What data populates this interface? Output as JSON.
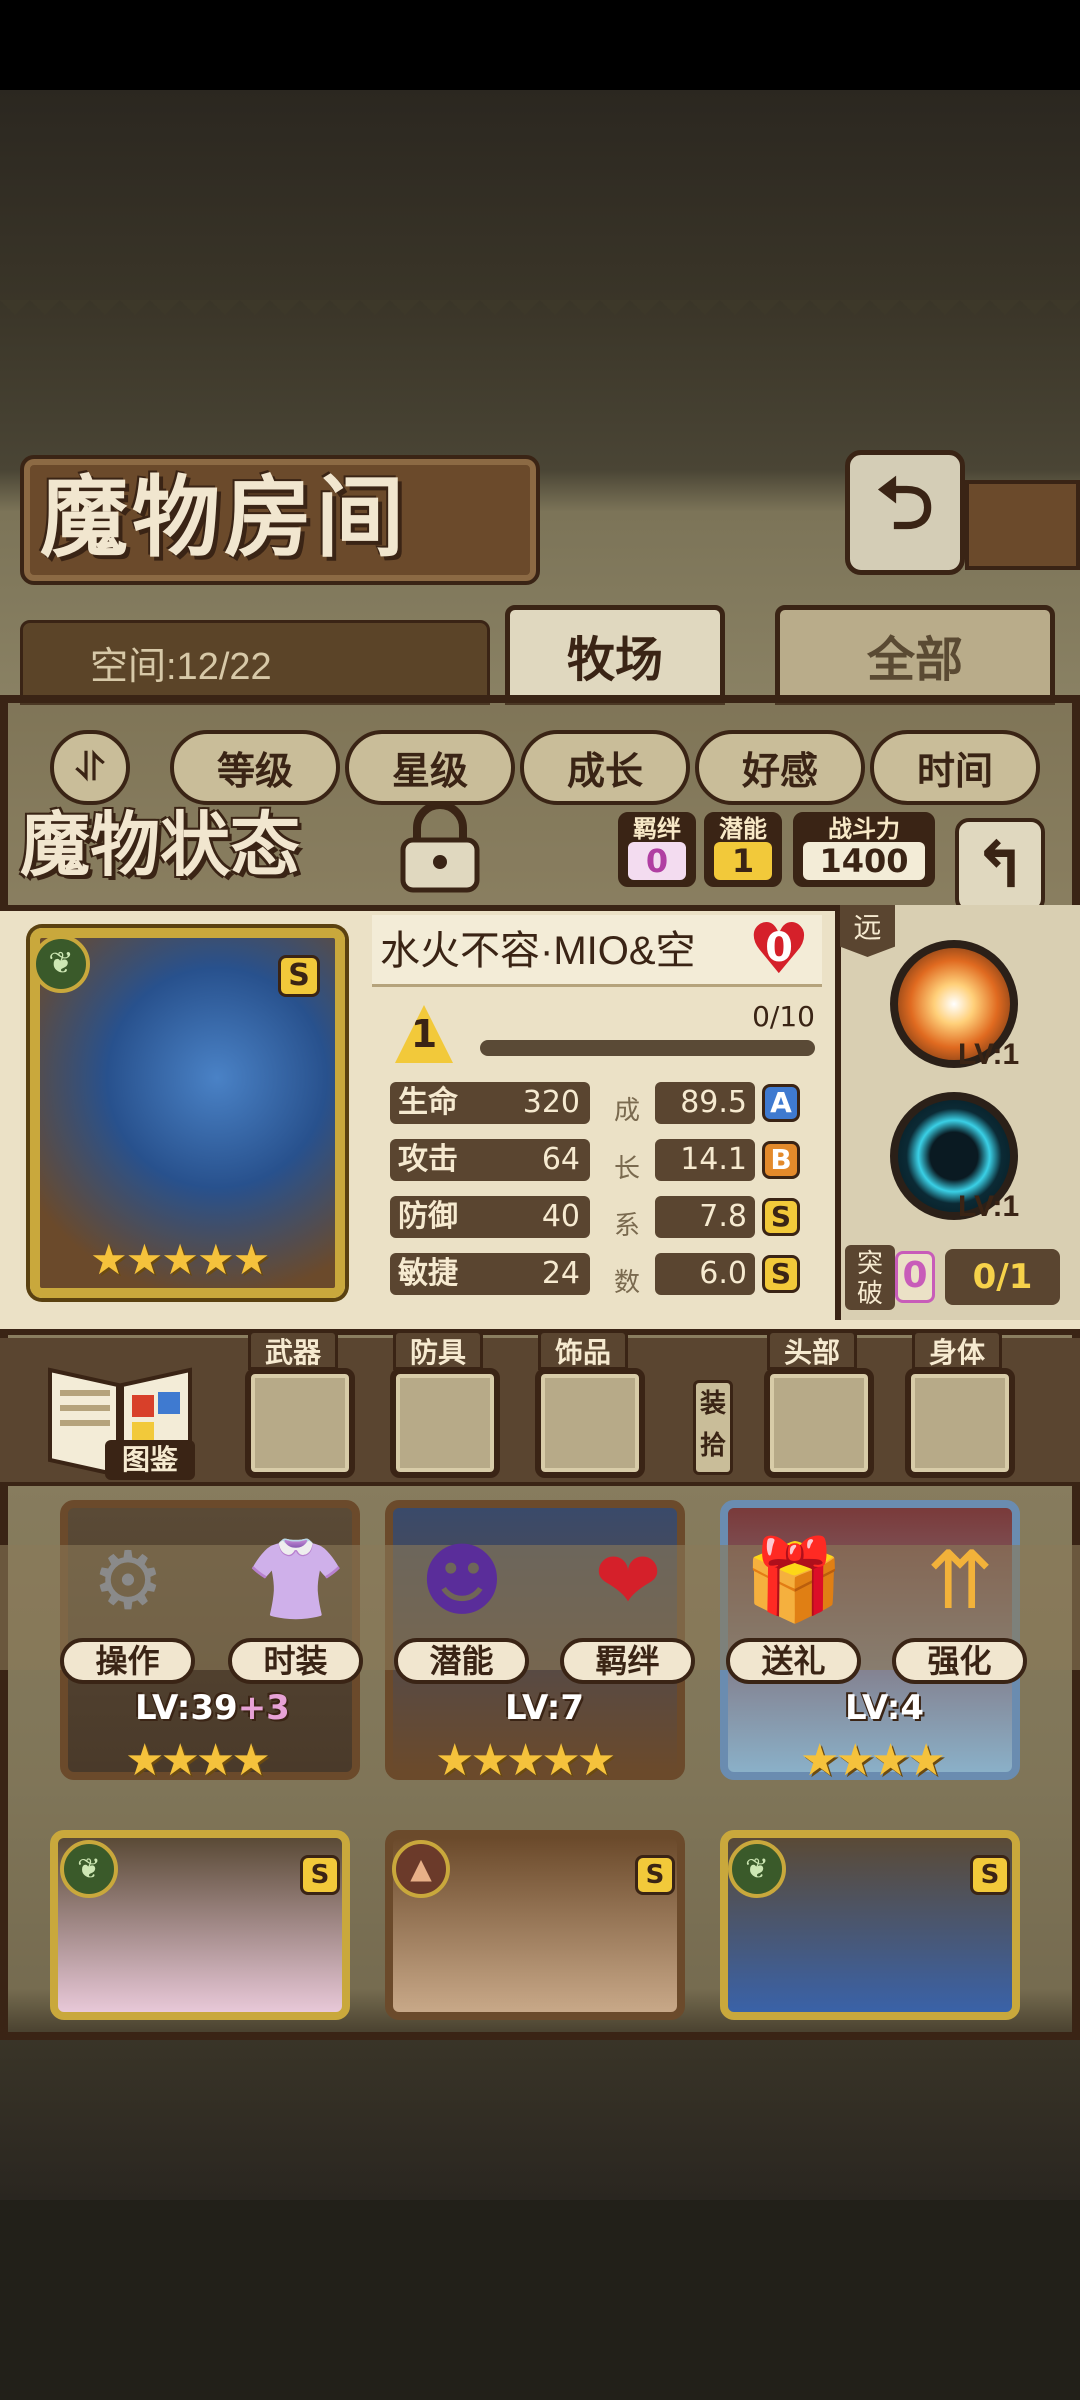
{
  "header": {
    "title": "魔物房间",
    "back_icon": "return-arrow-icon"
  },
  "space": {
    "label": "空间:12/22"
  },
  "tabs": [
    {
      "label": "牧场",
      "active": true
    },
    {
      "label": "全部",
      "active": false
    }
  ],
  "sort_buttons": [
    "等级",
    "星级",
    "成长",
    "好感",
    "时间"
  ],
  "status": {
    "title": "魔物状态",
    "bond_label": "羁绊",
    "bond_value": "0",
    "potential_label": "潜能",
    "potential_value": "1",
    "power_label": "战斗力",
    "power_value": "1400"
  },
  "monster": {
    "name": "水火不容·MIO&空",
    "affection": "0",
    "level": "1",
    "exp_text": "0/10",
    "exp_fraction": 0,
    "rank": "S",
    "stars": "★★★★★",
    "growth_chars": [
      "成",
      "长",
      "系",
      "数"
    ],
    "stats": [
      {
        "name": "生命",
        "value": "320",
        "growth": "89.5",
        "grade": "A"
      },
      {
        "name": "攻击",
        "value": "64",
        "growth": "14.1",
        "grade": "B"
      },
      {
        "name": "防御",
        "value": "40",
        "growth": "7.8",
        "grade": "S"
      },
      {
        "name": "敏捷",
        "value": "24",
        "growth": "6.0",
        "grade": "S"
      }
    ]
  },
  "skills": {
    "range_tag": "远",
    "skill_1_level": "LV:1",
    "skill_2_level": "LV:1"
  },
  "breakthrough": {
    "label": "突破",
    "count": "0",
    "progress": "0/1"
  },
  "equipment": {
    "codex_label": "图鉴",
    "weapon": "武器",
    "armor": "防具",
    "accessory": "饰品",
    "pickup": "装拾",
    "head": "头部",
    "body": "身体"
  },
  "actions": [
    {
      "label": "操作",
      "icon": "gear-icon"
    },
    {
      "label": "时装",
      "icon": "outfit-icon"
    },
    {
      "label": "潜能",
      "icon": "shadow-demon-icon"
    },
    {
      "label": "羁绊",
      "icon": "hearts-icon"
    },
    {
      "label": "送礼",
      "icon": "gift-icon"
    },
    {
      "label": "强化",
      "icon": "upgrade-arrows-icon"
    }
  ],
  "cards": [
    {
      "level": "LV:39",
      "bonus": "+3",
      "stars": "★★★★"
    },
    {
      "level": "LV:7",
      "bonus": "",
      "stars": "★★★★★"
    },
    {
      "level": "LV:4",
      "bonus": "",
      "stars": "★★★★"
    }
  ],
  "bottom_cards": [
    {
      "element": "leaf",
      "rank": "S"
    },
    {
      "element": "mountain",
      "rank": "S"
    },
    {
      "element": "leaf",
      "rank": "S"
    }
  ]
}
